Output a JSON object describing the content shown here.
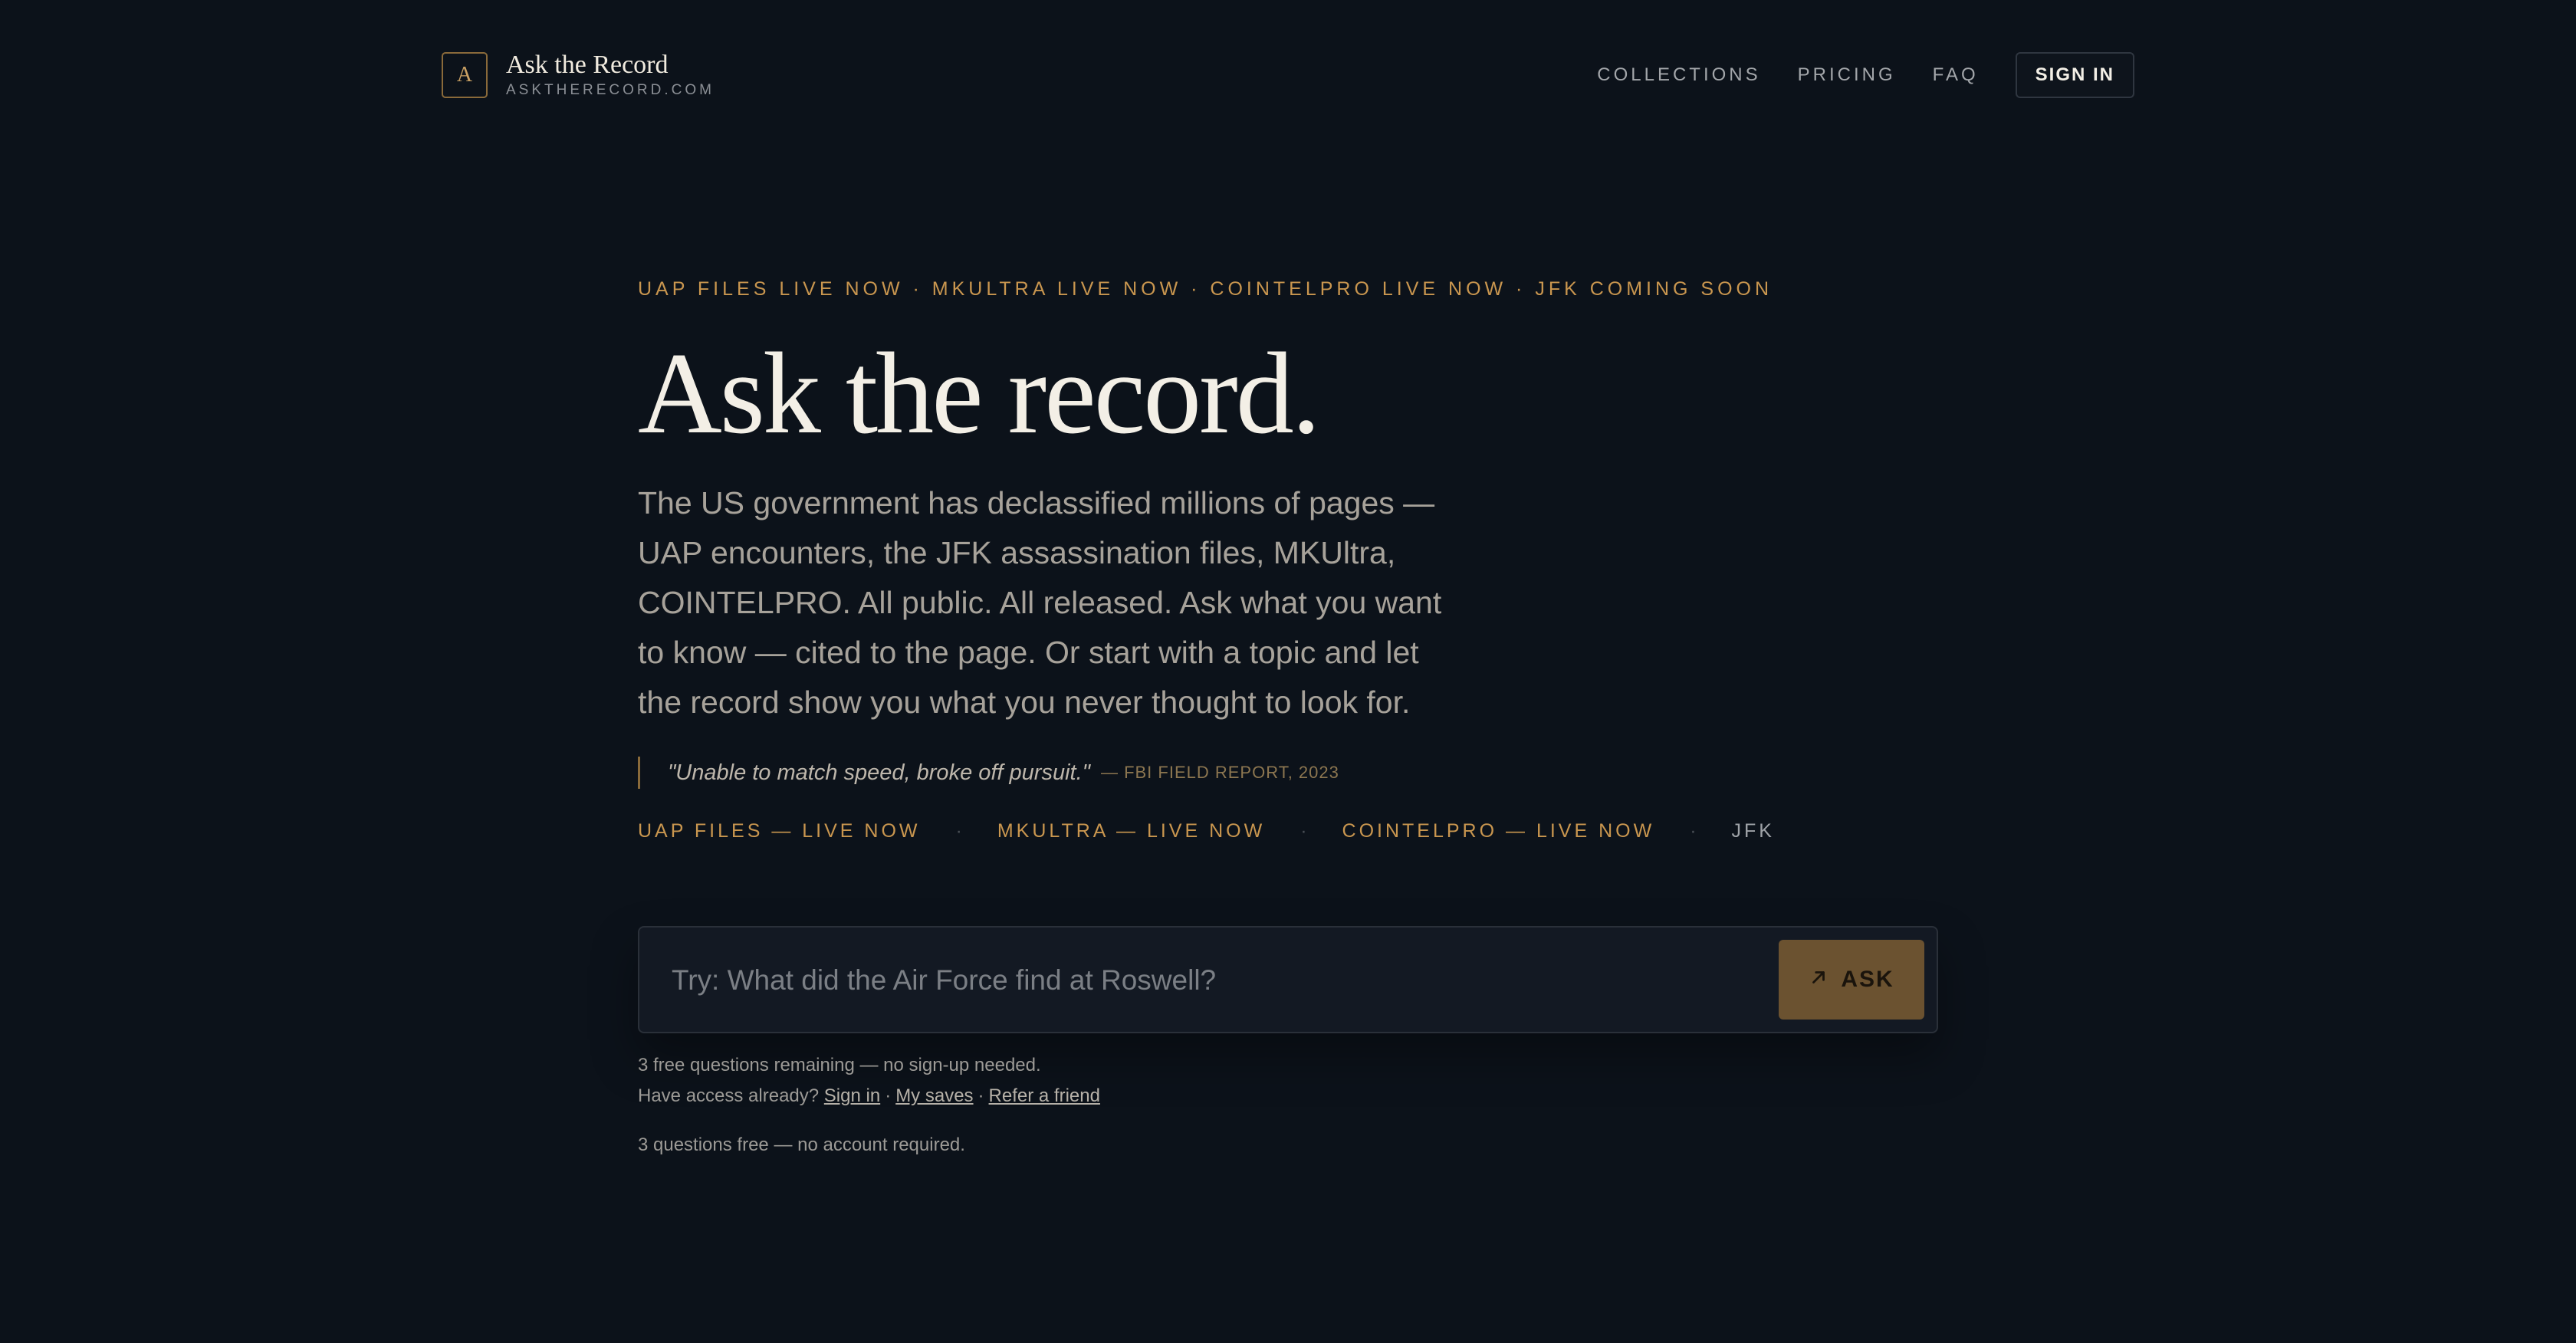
{
  "brand": {
    "logo_letter": "A",
    "name": "Ask the Record",
    "domain": "ASKTHERECORD.COM"
  },
  "nav": {
    "collections": "COLLECTIONS",
    "pricing": "PRICING",
    "faq": "FAQ",
    "sign_in": "SIGN IN"
  },
  "hero": {
    "ticker": "UAP FILES LIVE NOW · MKULTRA LIVE NOW · COINTELPRO LIVE NOW · JFK COMING SOON",
    "headline": "Ask the record.",
    "lede": "The US government has declassified millions of pages — UAP encounters, the JFK assassination files, MKUltra, COINTELPRO. All public. All released. Ask what you want to know — cited to the page. Or start with a topic and let the record show you what you never thought to look for.",
    "quote": "\"Unable to match speed, broke off pursuit.\"",
    "quote_cite": "— FBI FIELD REPORT, 2023"
  },
  "collections": [
    {
      "label": "UAP FILES — LIVE NOW",
      "live": true
    },
    {
      "label": "MKULTRA — LIVE NOW",
      "live": true
    },
    {
      "label": "COINTELPRO — LIVE NOW",
      "live": true
    },
    {
      "label": "JFK",
      "live": false
    }
  ],
  "collection_separator": "·",
  "ask": {
    "placeholder": "Try: What did the Air Force find at Roswell?",
    "value": "",
    "button_label": "ASK",
    "button_icon": "arrow-up-right-icon"
  },
  "notes": {
    "remaining": "3 free questions remaining — no sign-up needed.",
    "have_access": "Have access already?",
    "sign_in": "Sign in",
    "my_saves": "My saves",
    "refer": "Refer a friend",
    "separator": "·",
    "final": "3 questions free — no account required."
  },
  "colors": {
    "background": "#0c121a",
    "accent": "#c9964f",
    "button": "#6b5230"
  }
}
